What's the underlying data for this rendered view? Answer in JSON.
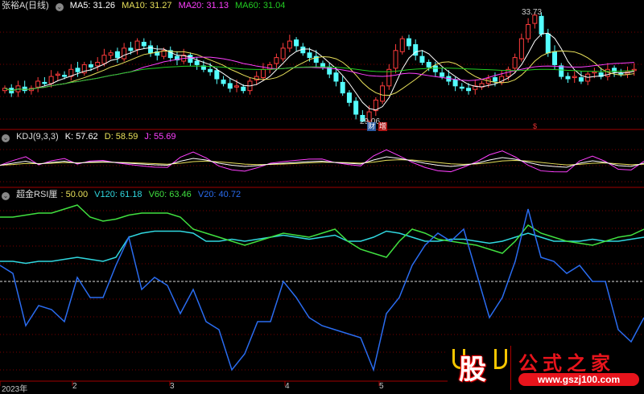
{
  "main": {
    "stock_name": "张裕A",
    "period": "(日线)",
    "ma5": "MA5: 31.26",
    "ma10": "MA10: 31.27",
    "ma20": "MA20: 31.13",
    "ma60": "MA60: 31.04",
    "high_label": "33.73",
    "low_label": "29.06",
    "markers": [
      "财",
      "增",
      "$"
    ]
  },
  "kdj": {
    "name": "KDJ(9,3,3)",
    "k": "K: 57.62",
    "d": "D: 58.59",
    "j": "J: 55.69"
  },
  "rsi": {
    "name": "超金RSI厘",
    "base": ": 50.00",
    "v120": "V120: 61.18",
    "v60": "V60: 63.46",
    "v20": "V20: 40.72"
  },
  "axis": {
    "labels": [
      "2023年",
      "2",
      "3",
      "4",
      "5"
    ]
  },
  "logo": {
    "title": "公式之家",
    "url": "www.gszj100.com",
    "glyph": "股"
  },
  "colors": {
    "up": "#ff3c3c",
    "down": "#54ffff",
    "ma5": "#ffffff",
    "ma10": "#e8e05a",
    "ma20": "#ff40ff",
    "ma60": "#22cc22",
    "v120": "#30d8e0",
    "v60": "#40e040",
    "v20": "#2a6cf0",
    "grid": "#7a0000"
  },
  "chart_data": {
    "type": "candlestick",
    "price_range": [
      29.06,
      33.73
    ],
    "closes": [
      30.5,
      30.3,
      30.6,
      30.4,
      30.5,
      30.8,
      30.7,
      31.0,
      31.1,
      31.0,
      31.3,
      31.2,
      31.5,
      31.4,
      31.6,
      31.9,
      32.0,
      31.8,
      32.2,
      32.1,
      32.5,
      32.3,
      32.0,
      31.9,
      32.1,
      31.8,
      31.7,
      31.9,
      31.6,
      31.5,
      31.3,
      31.2,
      30.9,
      30.7,
      30.5,
      30.6,
      30.4,
      30.8,
      31.0,
      31.3,
      31.5,
      31.8,
      32.2,
      32.5,
      32.3,
      32.0,
      31.8,
      31.6,
      31.4,
      31.1,
      30.8,
      30.3,
      29.9,
      29.4,
      29.1,
      29.5,
      30.0,
      30.6,
      31.3,
      32.1,
      32.6,
      32.3,
      31.9,
      31.6,
      31.4,
      31.2,
      31.0,
      30.8,
      30.6,
      30.5,
      30.4,
      30.6,
      30.7,
      30.9,
      30.8,
      31.0,
      31.3,
      31.8,
      32.6,
      33.2,
      33.6,
      32.8,
      32.0,
      31.5,
      31.0,
      30.9,
      31.0,
      30.8,
      31.1,
      31.2,
      31.0,
      31.3,
      31.2,
      31.1,
      31.2,
      31.3
    ],
    "kdj_k": [
      45,
      50,
      55,
      48,
      52,
      55,
      50,
      53,
      54,
      52,
      50,
      48,
      46,
      45,
      55,
      62,
      58,
      50,
      45,
      42,
      44,
      48,
      50,
      52,
      54,
      55,
      52,
      50,
      48,
      58,
      66,
      62,
      56,
      50,
      45,
      42,
      45,
      50,
      58,
      64,
      60,
      52,
      45,
      42,
      40,
      50,
      56,
      52,
      44,
      42,
      50
    ],
    "rsi_v120": [
      60,
      60,
      59,
      60,
      60,
      61,
      62,
      61,
      60,
      62,
      72,
      74,
      75,
      75,
      75,
      74,
      70,
      70,
      71,
      70,
      71,
      72,
      73,
      72,
      71,
      72,
      73,
      70,
      70,
      72,
      75,
      74,
      72,
      70,
      70,
      71,
      71,
      70,
      69,
      70,
      72,
      74,
      72,
      70,
      70,
      70,
      71,
      70,
      70,
      71,
      72
    ],
    "rsi_v60": [
      82,
      82,
      83,
      84,
      84,
      86,
      88,
      82,
      80,
      81,
      83,
      84,
      84,
      84,
      82,
      76,
      74,
      72,
      70,
      68,
      70,
      72,
      74,
      73,
      72,
      74,
      76,
      70,
      66,
      64,
      62,
      70,
      76,
      74,
      71,
      70,
      69,
      68,
      66,
      64,
      70,
      78,
      74,
      72,
      70,
      69,
      68,
      70,
      72,
      73,
      76
    ],
    "rsi_v20": [
      58,
      54,
      28,
      38,
      36,
      30,
      52,
      42,
      42,
      58,
      72,
      46,
      52,
      48,
      34,
      46,
      30,
      26,
      6,
      14,
      30,
      30,
      50,
      42,
      32,
      28,
      26,
      24,
      22,
      6,
      34,
      42,
      58,
      68,
      74,
      70,
      76,
      54,
      32,
      42,
      60,
      86,
      62,
      60,
      54,
      58,
      50,
      50,
      26,
      20,
      32
    ],
    "rsi_reference": 50
  }
}
